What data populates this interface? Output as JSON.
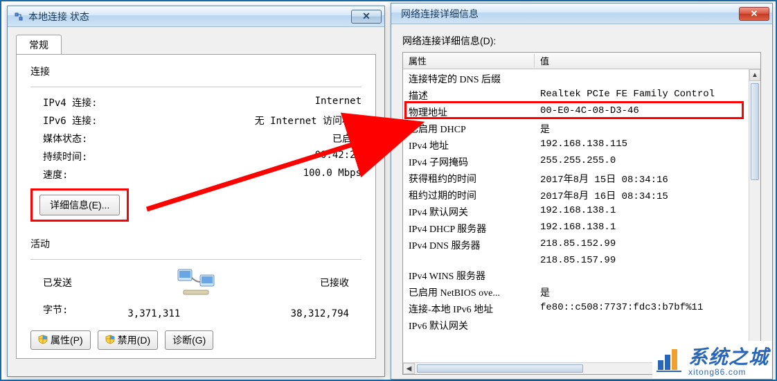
{
  "left": {
    "title": "本地连接 状态",
    "tab": "常规",
    "section_connect": "连接",
    "rows": [
      {
        "k": "IPv4 连接:",
        "v": "Internet"
      },
      {
        "k": "IPv6 连接:",
        "v": "无 Internet 访问权限"
      },
      {
        "k": "媒体状态:",
        "v": "已启用"
      },
      {
        "k": "持续时间:",
        "v": "00:42:27"
      },
      {
        "k": "速度:",
        "v": "100.0 Mbps"
      }
    ],
    "details_btn": "详细信息(E)...",
    "section_activity": "活动",
    "sent_label": "已发送",
    "recv_label": "已接收",
    "bytes_label": "字节:",
    "sent_val": "3,371,311",
    "recv_val": "38,312,794",
    "btn_props": "属性(P)",
    "btn_disable": "禁用(D)",
    "btn_diag": "诊断(G)"
  },
  "right": {
    "title": "网络连接详细信息",
    "list_label": "网络连接详细信息(D):",
    "col_prop": "属性",
    "col_val": "值",
    "rows": [
      {
        "p": "连接特定的 DNS 后缀",
        "v": ""
      },
      {
        "p": "描述",
        "v": "Realtek PCIe FE Family Control"
      },
      {
        "p": "物理地址",
        "v": "00-E0-4C-08-D3-46"
      },
      {
        "p": "已启用 DHCP",
        "v": "是"
      },
      {
        "p": "IPv4 地址",
        "v": "192.168.138.115"
      },
      {
        "p": "IPv4 子网掩码",
        "v": "255.255.255.0"
      },
      {
        "p": "获得租约的时间",
        "v": "2017年8月 15日 08:34:16"
      },
      {
        "p": "租约过期的时间",
        "v": "2017年8月 16日 08:34:15"
      },
      {
        "p": "IPv4 默认网关",
        "v": "192.168.138.1"
      },
      {
        "p": "IPv4 DHCP 服务器",
        "v": "192.168.138.1"
      },
      {
        "p": "IPv4 DNS 服务器",
        "v": "218.85.152.99"
      },
      {
        "p": "",
        "v": "218.85.157.99"
      },
      {
        "p": "IPv4 WINS 服务器",
        "v": ""
      },
      {
        "p": "已启用 NetBIOS ove...",
        "v": "是"
      },
      {
        "p": "连接-本地 IPv6 地址",
        "v": "fe80::c508:7737:fdc3:b7bf%11"
      },
      {
        "p": "IPv6 默认网关",
        "v": ""
      }
    ]
  },
  "watermark": {
    "cn": "系统之城",
    "en": "xitong86.com"
  }
}
